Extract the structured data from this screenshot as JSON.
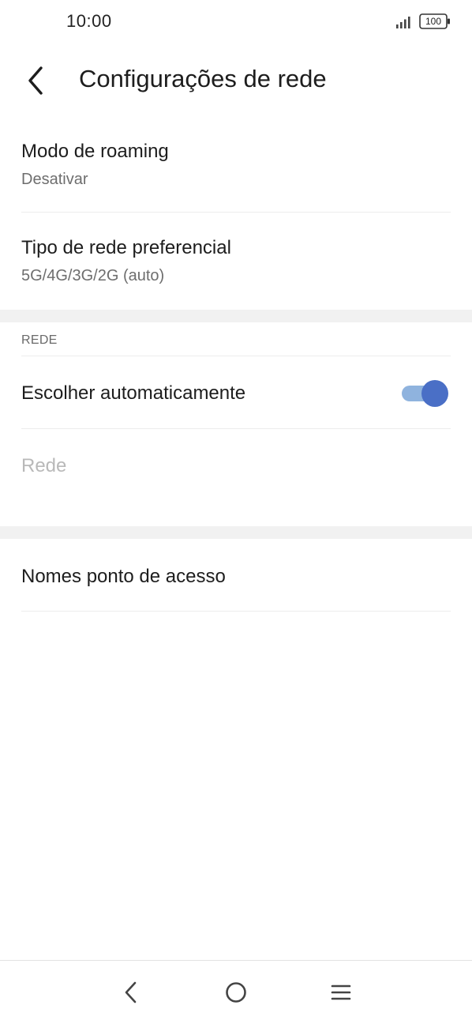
{
  "status_bar": {
    "time": "10:00",
    "battery": "100",
    "icons": [
      "signal-icon",
      "battery-icon"
    ]
  },
  "header": {
    "back_icon": "back-arrow-icon",
    "title": "Configurações de rede"
  },
  "settings": {
    "roaming": {
      "title": "Modo de roaming",
      "value": "Desativar"
    },
    "preferred_network": {
      "title": "Tipo de rede preferencial",
      "value": "5G/4G/3G/2G (auto)"
    },
    "network_section": {
      "header": "REDE",
      "auto_select": {
        "title": "Escolher automaticamente",
        "enabled": true
      },
      "network": {
        "title": "Rede",
        "disabled": true
      }
    },
    "apn": {
      "title": "Nomes ponto de acesso"
    }
  },
  "colors": {
    "toggle_track": "#8fb3de",
    "toggle_thumb": "#4a6fc6",
    "section_band": "#f1f1f1"
  },
  "nav_bar": {
    "buttons": [
      "back-icon",
      "home-icon",
      "menu-icon"
    ]
  }
}
